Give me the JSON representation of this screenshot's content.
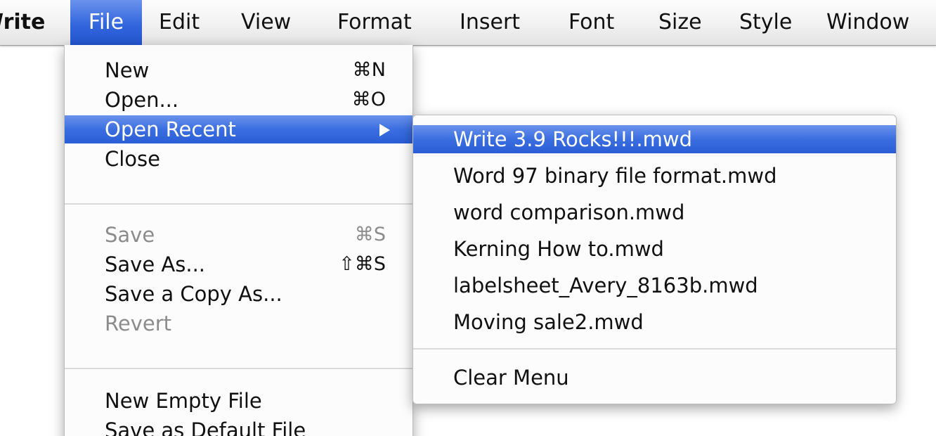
{
  "menubar": {
    "app": "Write",
    "items": [
      "File",
      "Edit",
      "View",
      "Format",
      "Insert",
      "Font",
      "Size",
      "Style",
      "Window"
    ],
    "active": "File"
  },
  "file_menu": {
    "items": [
      {
        "label": "New",
        "shortcut": "⌘N",
        "enabled": true
      },
      {
        "label": "Open...",
        "shortcut": "⌘O",
        "enabled": true
      },
      {
        "label": "Open Recent",
        "shortcut": "",
        "enabled": true,
        "submenu": true,
        "highlighted": true
      },
      {
        "label": "Close",
        "shortcut": "",
        "enabled": true
      },
      {
        "label": "Save",
        "shortcut": "⌘S",
        "enabled": false
      },
      {
        "label": "Save As...",
        "shortcut": "⇧⌘S",
        "enabled": true
      },
      {
        "label": "Save a Copy As...",
        "shortcut": "",
        "enabled": true
      },
      {
        "label": "Revert",
        "shortcut": "",
        "enabled": false
      },
      {
        "label": "New Empty File",
        "shortcut": "",
        "enabled": true
      },
      {
        "label": "Save as Default File",
        "shortcut": "",
        "enabled": true
      }
    ]
  },
  "open_recent_menu": {
    "items": [
      {
        "label": "Write 3.9 Rocks!!!.mwd",
        "highlighted": true
      },
      {
        "label": "Word 97 binary file format.mwd"
      },
      {
        "label": "word comparison.mwd"
      },
      {
        "label": "Kerning How to.mwd"
      },
      {
        "label": "labelsheet_Avery_8163b.mwd"
      },
      {
        "label": "Moving sale2.mwd"
      }
    ],
    "clear_label": "Clear Menu"
  },
  "colors": {
    "highlight": "#3a6ee0",
    "disabled_text": "#8c8c8c",
    "text": "#111111"
  }
}
